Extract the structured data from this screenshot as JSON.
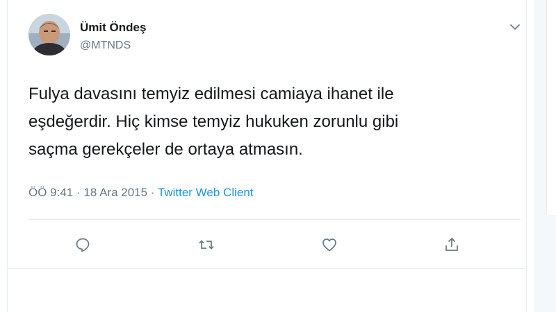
{
  "tweet": {
    "author": {
      "display_name": "Ümit Öndeş",
      "handle": "@MTNDS"
    },
    "text_lines": [
      "Fulya davasını temyiz edilmesi camiaya ihanet ile",
      "eşdeğerdir. Hiç kimse temyiz hukuken zorunlu gibi",
      "saçma gerekçeler de ortaya atmasın."
    ],
    "time": "ÖÖ 9:41",
    "separator": " · ",
    "date": "18 Ara 2015",
    "client": "Twitter Web Client",
    "icons": {
      "menu": "chevron-down-icon",
      "reply": "reply-icon",
      "retweet": "retweet-icon",
      "like": "heart-icon",
      "share": "share-icon"
    },
    "colors": {
      "text": "#14171a",
      "secondary": "#657786",
      "link": "#1b95e0",
      "border": "#e6ecf0"
    }
  }
}
